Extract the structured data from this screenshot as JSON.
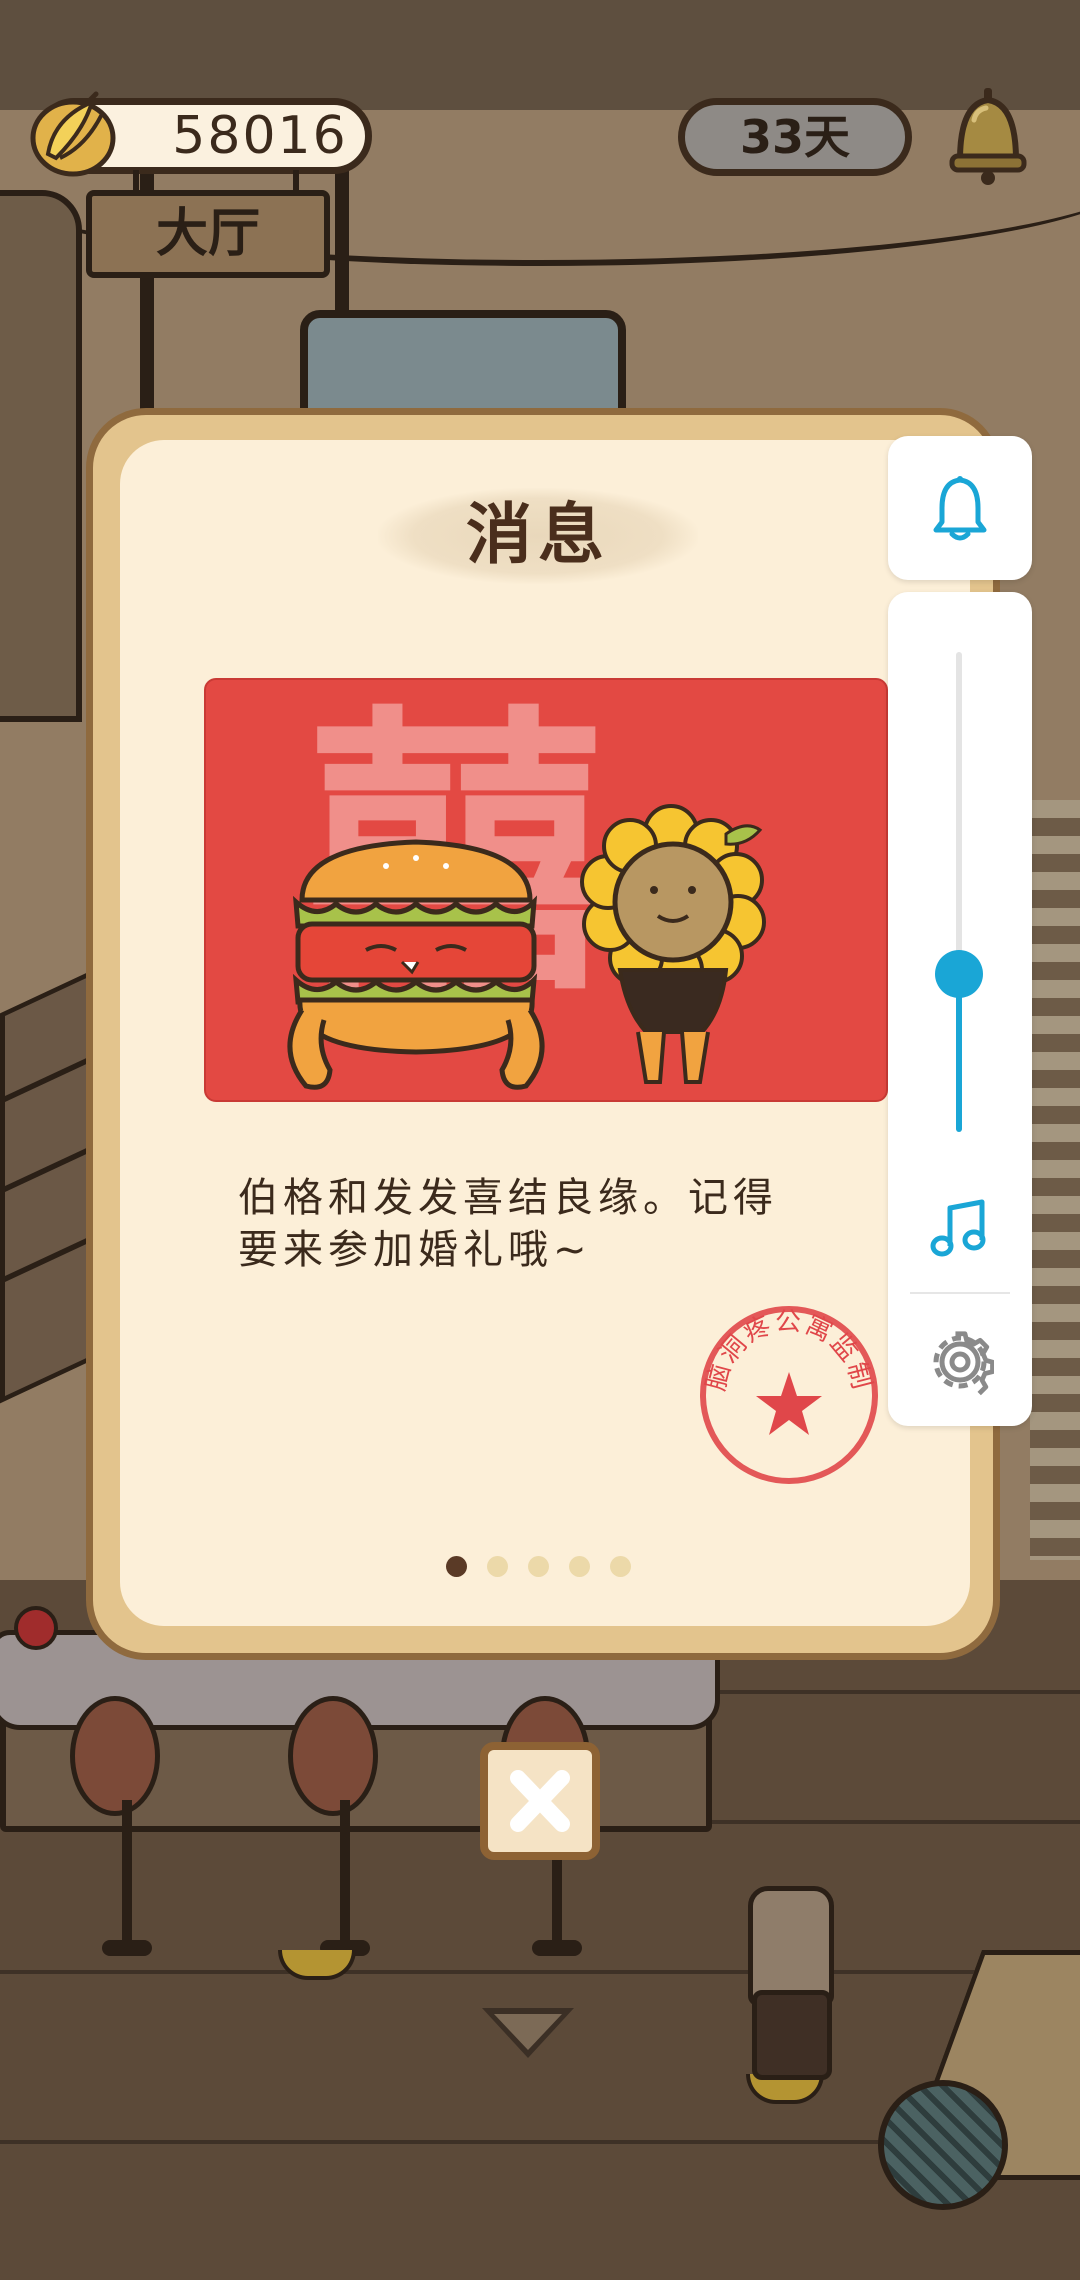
{
  "hud": {
    "banana_count": "58016",
    "room_name": "大厅",
    "days_label": "33天",
    "bell_icon": "bell-icon"
  },
  "dialog": {
    "title": "消息",
    "message": "伯格和发发喜结良缘。记得\n要来参加婚礼哦~",
    "image_background_text": "囍",
    "stamp_text": "脑洞疼公寓监制",
    "page_current": 1,
    "page_count": 5,
    "close_icon": "close-icon"
  },
  "side_panel": {
    "notification_icon": "bell-outline-icon",
    "volume_level": 0.33,
    "music_icon": "music-note-icon",
    "settings_icon": "gear-icon"
  },
  "colors": {
    "accent_blue": "#1aa6d6",
    "image_red": "#e34943",
    "stamp_red": "#e0474a",
    "dialog_frame": "#e3c48d",
    "dialog_bg": "#fcefd8",
    "title_brown": "#4a2e1c"
  }
}
